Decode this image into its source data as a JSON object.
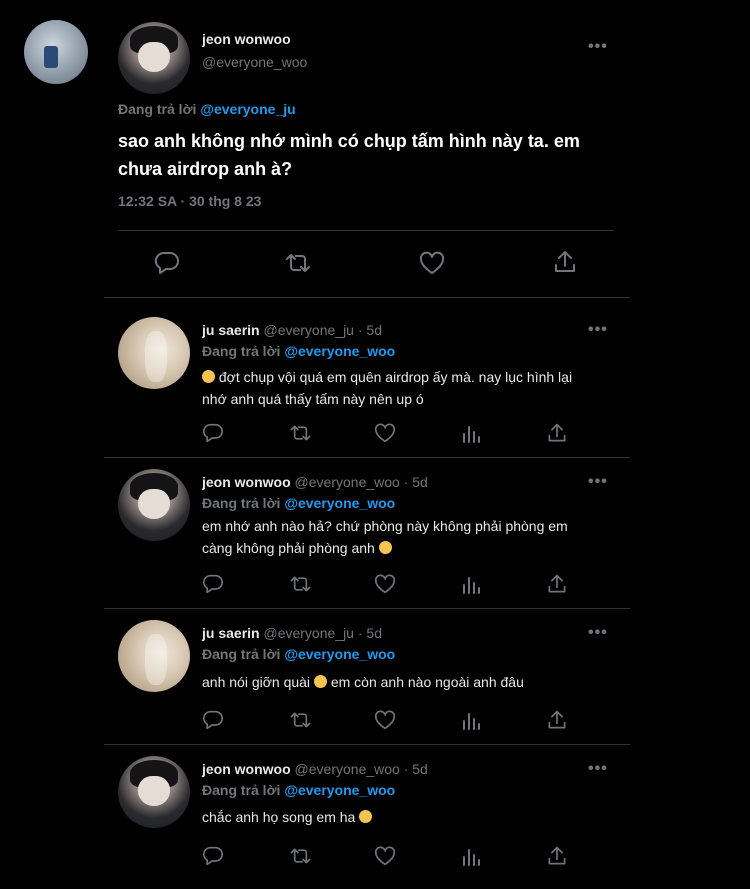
{
  "main_tweet": {
    "name": "jeon wonwoo",
    "handle": "@everyone_woo",
    "replying_prefix": "Đang trả lời",
    "replying_to": "@everyone_ju",
    "text": "sao anh không nhớ mình có chụp tấm hình này ta. em chưa airdrop anh à?",
    "timestamp": "12:32 SA · 30 thg 8 23",
    "more": "•••"
  },
  "replies": [
    {
      "name": "ju saerin",
      "handle": "@everyone_ju",
      "dot_time": "· 5d",
      "replying_prefix": "Đang trả lời",
      "replying_to": "@everyone_woo",
      "text_line1": "đợt chụp vội quá em quên airdrop ấy mà. nay lục hình lại",
      "text_line2": "nhớ anh quá thấy tấm này nên up ó",
      "more": "•••"
    },
    {
      "name": "jeon wonwoo",
      "handle": "@everyone_woo",
      "dot_time": "· 5d",
      "replying_prefix": "Đang trả lời",
      "replying_to": "@everyone_woo",
      "text_line1": "em nhớ anh nào hả? chứ phòng này không phải phòng em",
      "text_line2": "càng không phải phòng anh",
      "more": "•••"
    },
    {
      "name": "ju saerin",
      "handle": "@everyone_ju",
      "dot_time": "· 5d",
      "replying_prefix": "Đang trả lời",
      "replying_to": "@everyone_woo",
      "text_before": "anh nói giỡn quài",
      "text_after": "em còn anh nào ngoài anh đâu",
      "more": "•••"
    },
    {
      "name": "jeon wonwoo",
      "handle": "@everyone_woo",
      "dot_time": "· 5d",
      "replying_prefix": "Đang trả lời",
      "replying_to": "@everyone_woo",
      "text_line1": "chắc anh họ song em ha",
      "more": "•••"
    }
  ],
  "icons": {
    "reply": "reply-icon",
    "retweet": "retweet-icon",
    "like": "heart-icon",
    "views": "views-icon",
    "share": "share-icon",
    "more": "more-icon"
  },
  "colors": {
    "background": "#000000",
    "text": "#e7e9ea",
    "muted": "#71767b",
    "link": "#1d9bf0",
    "divider": "#2f3336"
  }
}
